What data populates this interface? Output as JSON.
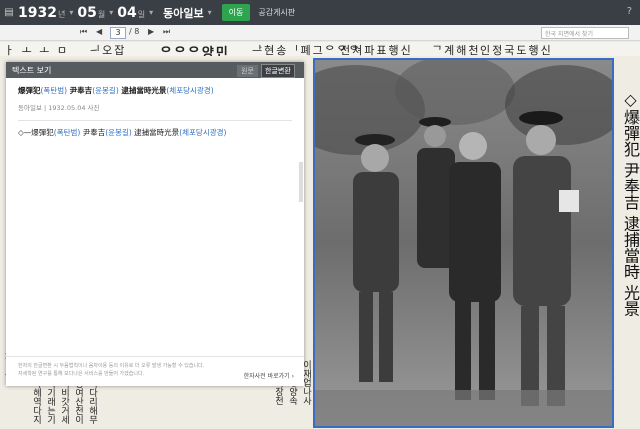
{
  "topbar": {
    "year": "1932",
    "year_unit": "년",
    "month": "05",
    "month_unit": "월",
    "day": "04",
    "day_unit": "일",
    "paper_name": "동아일보",
    "move_button": "이동",
    "notice_link": "공감게시판",
    "help_icon": "?"
  },
  "pager": {
    "current_page": "3",
    "separator": "/",
    "total_pages": "8",
    "search_placeholder": "한국 지면에서 찾기"
  },
  "newspaper": {
    "headline_strip": [
      "ㅏ  ㅗ  ㅗ  ㅁ",
      "ᅴ오잡",
      "ᄋᄋᄋ양민",
      "ᅡᅳ현송ᅵ폐그ᄋᄋᄋ",
      "전쳐파표행신",
      "ᄀ계해천",
      "인정국도행신"
    ],
    "photo_caption": "◇爆彈犯 尹奉吉 逮捕當時 光景"
  },
  "text_panel": {
    "title": "텍스트 보기",
    "original_button": "원문",
    "convert_button": "한글변환",
    "article_title_prefix": "爆彈犯",
    "article_title_reading1": "(폭탄범)",
    "article_title_name": " 尹奉吉",
    "article_title_reading2": "(윤봉길)",
    "article_title_rest": " 逮捕當時光景",
    "article_title_reading3": "(체포당시광경)",
    "meta": "동아일보 | 1932.05.04 사진",
    "body_prefix": "◇—爆彈犯",
    "body_reading1": "(폭탄범)",
    "body_name": " 尹奉吉",
    "body_reading2": "(윤봉길)",
    "body_rest": " 逮捕當時光景",
    "body_reading3": "(체포당시광경)",
    "footer_line1": "한자의 한글변환 시 두음법칙이나 음차이용 등의 이유로 더 오류 발생 가능할 수 있습니다.",
    "footer_line2": "자세학된 연구를 통해 보다나은 서비스를 만들어 가겠습니다.",
    "footer_link": "한자사전 바로가기 ›"
  }
}
